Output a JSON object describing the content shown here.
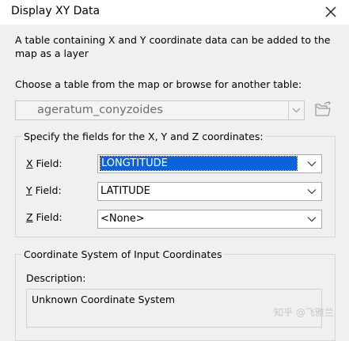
{
  "window": {
    "title": "Display XY Data"
  },
  "intro": {
    "line1": "A table containing X and Y coordinate data can be added to the",
    "line2": "map as a layer"
  },
  "table_choose": {
    "label": "Choose a table from the map or browse for another table:",
    "selected": "ageratum_conyzoides"
  },
  "fields": {
    "group_label": "Specify the fields for the X, Y and Z coordinates:",
    "x": {
      "key": "X",
      "rest": " Field:",
      "value": "LONGTITUDE"
    },
    "y": {
      "key": "Y",
      "rest": " Field:",
      "value": "LATITUDE"
    },
    "z": {
      "key": "Z",
      "rest": " Field:",
      "value": "<None>"
    }
  },
  "coord": {
    "group_label": "Coordinate System of Input Coordinates",
    "description_label": "Description:",
    "description_value": "Unknown Coordinate System"
  },
  "watermark": "知乎 @飞雅兰",
  "icons": {
    "close": "close-icon",
    "browse": "folder-browse-icon",
    "dropdown": "chevron-down-icon"
  },
  "colors": {
    "selection": "#0a64d8",
    "titlebar": "#ffffff",
    "dialog": "#f0f0f0"
  }
}
